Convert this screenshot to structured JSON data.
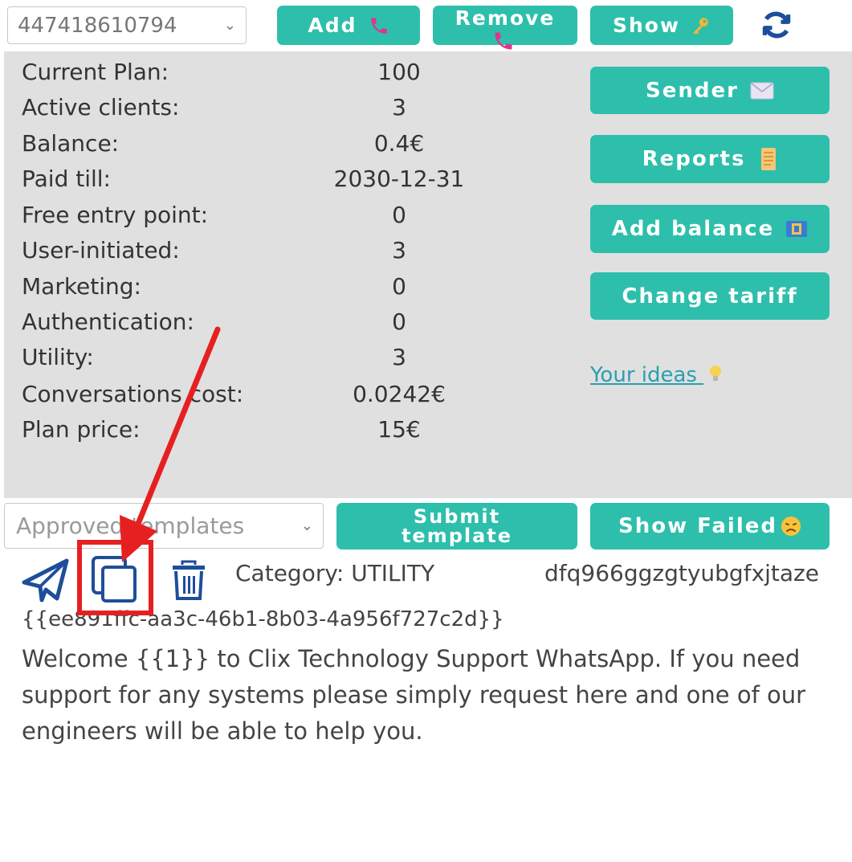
{
  "toolbar": {
    "phone_value": "447418610794",
    "add_label": "Add",
    "remove_label": "Remove",
    "show_label": "Show"
  },
  "stats": [
    {
      "label": "Current Plan:",
      "value": "100"
    },
    {
      "label": "Active clients:",
      "value": "3"
    },
    {
      "label": "Balance:",
      "value": "0.4€"
    },
    {
      "label": "Paid till:",
      "value": "2030-12-31"
    },
    {
      "label": "Free entry point:",
      "value": "0"
    },
    {
      "label": "User-initiated:",
      "value": "3"
    },
    {
      "label": "Marketing:",
      "value": "0"
    },
    {
      "label": "Authentication:",
      "value": "0"
    },
    {
      "label": "Utility:",
      "value": "3"
    },
    {
      "label": "Conversations cost:",
      "value": "0.0242€"
    },
    {
      "label": "Plan price:",
      "value": "15€"
    }
  ],
  "side_actions": {
    "sender_label": "Sender",
    "reports_label": "Reports",
    "add_balance_label": "Add balance",
    "change_tariff_label": "Change tariff",
    "ideas_link": "Your ideas"
  },
  "templates_bar": {
    "select_placeholder": "Approved templates",
    "submit_line1": "Submit",
    "submit_line2": "template",
    "show_failed_label": "Show Failed"
  },
  "template": {
    "category": "Category: UTILITY",
    "name": "dfq966ggzgtyubgfxjtaze",
    "id": "{{ee891ffc-aa3c-46b1-8b03-4a956f727c2d}}",
    "body": "Welcome {{1}} to Clix Technology Support WhatsApp. If you need support for any systems please simply request here and one of our engineers will be able to help you."
  },
  "colors": {
    "accent": "#2dbfab",
    "panel": "#e0e0e0",
    "annotation": "#e62020",
    "icon_blue": "#1d4e9a"
  }
}
